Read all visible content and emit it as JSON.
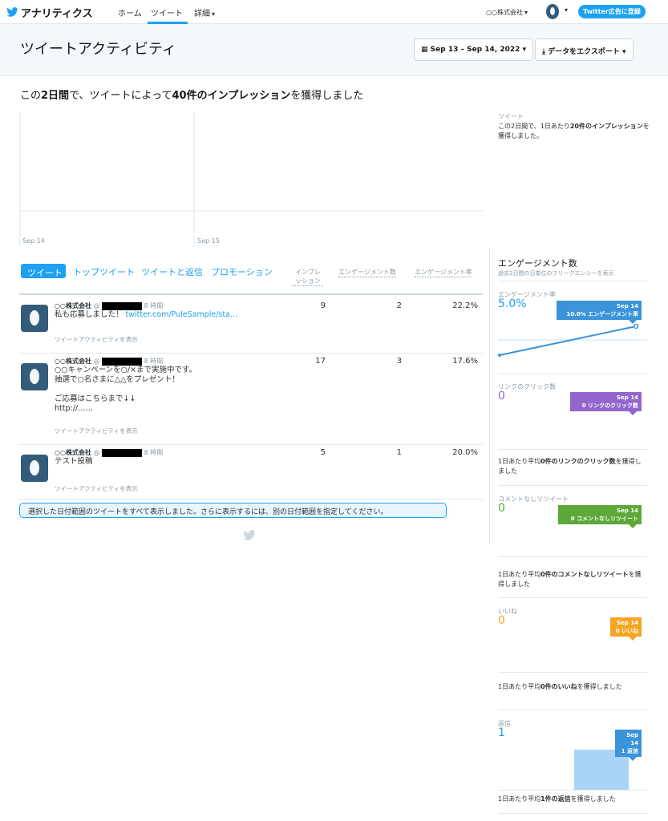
{
  "nav": {
    "brand": "アナリティクス",
    "home": "ホーム",
    "tweets": "ツイート",
    "more": "詳細",
    "account": "○○株式会社",
    "ads_button": "Twitter広告に登録"
  },
  "header": {
    "title": "ツイートアクティビティ",
    "date_range": "Sep 13 – Sep 14, 2022",
    "export": "データをエクスポート"
  },
  "summary": {
    "pre": "この",
    "period": "2日間",
    "mid": "で、ツイートによって",
    "count": "40件のインプレッション",
    "post": "を獲得しました"
  },
  "chart_data": {
    "type": "bar",
    "categories": [
      "Sep 14",
      "Sep 15"
    ],
    "values": [
      0,
      0
    ]
  },
  "side_summary": {
    "label": "ツイート",
    "text_pre": "この2日間で、1日あたり",
    "text_bold": "20件のインプレッション",
    "text_post": "を獲得しました。"
  },
  "tabs": [
    "ツイート",
    "トップツイート",
    "ツイートと返信",
    "プロモーション"
  ],
  "columns": {
    "impressions_1": "インプレ",
    "impressions_2": "ッション",
    "engagements": "エンゲージメント数",
    "rate": "エンゲージメント率"
  },
  "tweets": [
    {
      "account": "○○株式会社",
      "handle": "@",
      "time": "8 時間",
      "line1": "私も応募しました！",
      "link": "twitter.com/PuleSample/sta…",
      "line2": "",
      "line3": "",
      "line4": "",
      "activity": "ツイートアクティビティを表示",
      "impressions": "9",
      "engagements": "2",
      "rate": "22.2%"
    },
    {
      "account": "○○株式会社",
      "handle": "@",
      "time": "8 時間",
      "line1": "○○キャンペーンを○/×まで実施中です。",
      "link": "",
      "line2": "抽選で○名さまに△△をプレゼント！",
      "line3": "ご応募はこちらまで↓↓",
      "line4": "http://……",
      "activity": "ツイートアクティビティを表示",
      "impressions": "17",
      "engagements": "3",
      "rate": "17.6%"
    },
    {
      "account": "○○株式会社",
      "handle": "@",
      "time": "8 時間",
      "line1": "テスト投稿",
      "link": "",
      "line2": "",
      "line3": "",
      "line4": "",
      "activity": "ツイートアクティビティを表示",
      "impressions": "5",
      "engagements": "1",
      "rate": "20.0%"
    }
  ],
  "notice": "選択した日付範囲のツイートをすべて表示しました。さらに表示するには、別の日付範囲を指定してください。",
  "engagement_panel": {
    "title": "エンゲージメント数",
    "subtitle": "過去2日間の日単位のフリークエンシーを表示",
    "rate": {
      "label": "エンゲージメント率",
      "value": "5.0%",
      "tag_date": "Sep 14",
      "tag_text": "10.0% エンゲージメント率",
      "color": "#3b94d9"
    },
    "link_clicks": {
      "label": "リンクのクリック数",
      "value": "0",
      "tag_date": "Sep 14",
      "tag_text": "0 リンクのクリック数",
      "color": "#9266cc",
      "summary_pre": "1日あたり平均",
      "summary_bold": "0件のリンクのクリック数",
      "summary_post": "を獲得しました"
    },
    "retweets": {
      "label": "コメントなしリツイート",
      "value": "0",
      "tag_date": "Sep 14",
      "tag_text": "0 コメントなしリツイート",
      "color": "#5ca839",
      "summary_pre": "1日あたり平均",
      "summary_bold": "0件のコメントなしリツイート",
      "summary_post": "を獲得しました"
    },
    "likes": {
      "label": "いいね",
      "value": "0",
      "tag_date": "Sep 14",
      "tag_text": "0 いいね",
      "color": "#f5a623",
      "summary_pre": "1日あたり平均",
      "summary_bold": "0件のいいね",
      "summary_post": "を獲得しました"
    },
    "replies": {
      "label": "返信",
      "value": "1",
      "tag_date": "Sep 14",
      "tag_text": "1 返信",
      "color": "#3b94d9",
      "summary_pre": "1日あたり平均",
      "summary_bold": "1件の返信",
      "summary_post": "を獲得しました"
    }
  }
}
